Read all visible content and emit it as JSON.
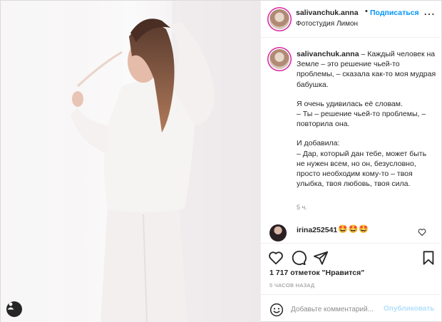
{
  "photo": {
    "alt_icon": "user-tag-icon"
  },
  "header": {
    "username": "salivanchuk.anna",
    "dot": "•",
    "follow_label": "Подписаться",
    "location": "Фотостудия Лимон",
    "more_icon": "more-horizontal-icon"
  },
  "caption": {
    "username": "salivanchuk.anna",
    "paragraphs": [
      " – Каждый человек на Земле – это решение чьей-то проблемы, – сказала как-то моя мудрая бабушка.",
      "Я очень удивилась её словам.\n– Ты – решение чьей-то проблемы, – повторила она.",
      "И добавила:\n– Дар, который дан тебе, может быть не нужен всем, но он, безусловно, просто необходим кому-то – твоя улыбка, твоя любовь, твоя сила."
    ],
    "time": "5 ч."
  },
  "comment": {
    "username": "irina252541",
    "text": "🤩🤩🤩"
  },
  "actions": {
    "like_icon": "heart-icon",
    "comment_icon": "comment-icon",
    "share_icon": "share-icon",
    "save_icon": "bookmark-icon"
  },
  "likes_text": "1 717 отметок \"Нравится\"",
  "time_ago": "5 часов назад",
  "add_comment": {
    "placeholder": "Добавьте комментарий...",
    "post_label": "Опубликовать"
  },
  "colors": {
    "accent": "#0095f6",
    "post_disabled": "#b2dffc",
    "text": "#262626",
    "muted": "#8e8e8e",
    "border": "#dbdbdb"
  }
}
